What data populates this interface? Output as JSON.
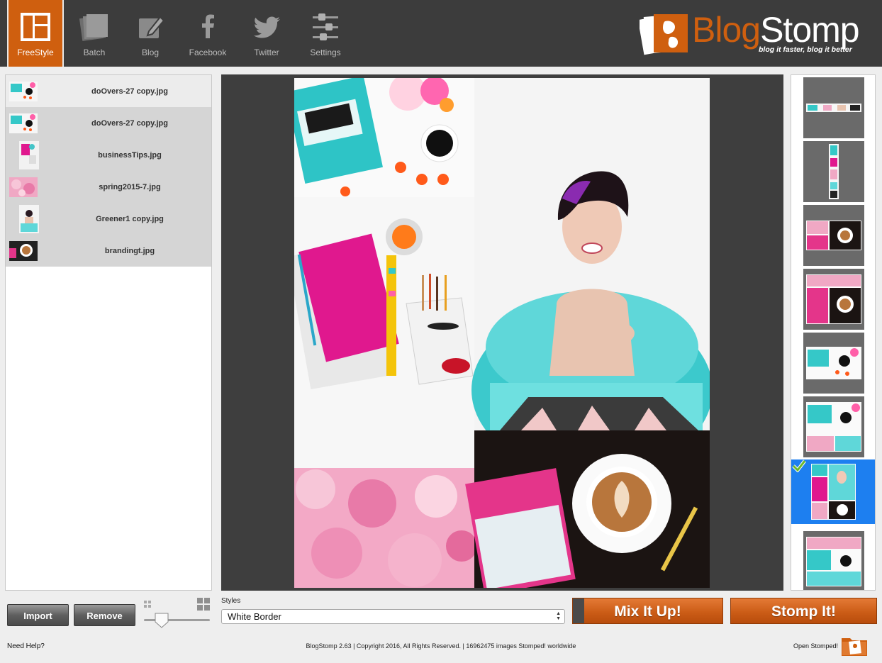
{
  "toolbar": {
    "items": [
      {
        "label": "FreeStyle",
        "icon": "freestyle-layout-icon",
        "active": true
      },
      {
        "label": "Batch",
        "icon": "batch-stack-icon"
      },
      {
        "label": "Blog",
        "icon": "blog-edit-icon"
      },
      {
        "label": "Facebook",
        "icon": "facebook-icon"
      },
      {
        "label": "Twitter",
        "icon": "twitter-bird-icon"
      },
      {
        "label": "Settings",
        "icon": "settings-sliders-icon"
      }
    ]
  },
  "logo": {
    "brand_part1": "Blog",
    "brand_part2": "Stomp",
    "tagline": "blog it faster, blog it better"
  },
  "files": [
    {
      "name": "doOvers-27 copy.jpg"
    },
    {
      "name": "doOvers-27 copy.jpg"
    },
    {
      "name": "businessTips.jpg"
    },
    {
      "name": "spring2015-7.jpg"
    },
    {
      "name": "Greener1 copy.jpg"
    },
    {
      "name": "brandingt.jpg"
    }
  ],
  "buttons": {
    "import": "Import",
    "remove": "Remove",
    "mix": "Mix It Up!",
    "stomp": "Stomp It!"
  },
  "styles": {
    "label": "Styles",
    "selected": "White Border"
  },
  "footer": {
    "help": "Need Help?",
    "copyright": "BlogStomp 2.63 | Copyright 2016, All Rights Reserved. | 16962475 images Stomped! worldwide",
    "open": "Open Stomped!"
  },
  "colors": {
    "accent": "#cf5f0f",
    "toolbar": "#3c3c3c",
    "selection": "#1d7ff0"
  }
}
